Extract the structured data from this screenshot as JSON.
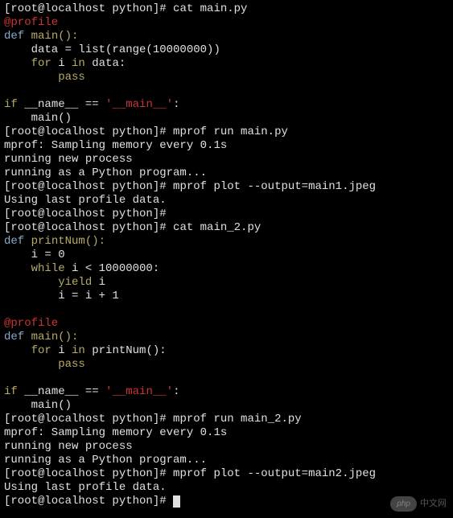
{
  "prompt": {
    "user_host": "root@localhost",
    "path": "python"
  },
  "lines": [
    {
      "type": "prompt",
      "command": "cat main.py"
    },
    {
      "type": "code_red",
      "text": "@profile"
    },
    {
      "type": "code",
      "parts": [
        {
          "c": "lightblue",
          "t": "def "
        },
        {
          "c": "yellow",
          "t": "main():"
        }
      ]
    },
    {
      "type": "code_plain",
      "text": "    data = list(range(10000000))"
    },
    {
      "type": "code",
      "parts": [
        {
          "c": "yellow",
          "t": "    for "
        },
        {
          "c": "",
          "t": "i "
        },
        {
          "c": "yellow",
          "t": "in "
        },
        {
          "c": "",
          "t": "data:"
        }
      ]
    },
    {
      "type": "code",
      "parts": [
        {
          "c": "yellow",
          "t": "        pass"
        }
      ]
    },
    {
      "type": "blank"
    },
    {
      "type": "code",
      "parts": [
        {
          "c": "yellow",
          "t": "if "
        },
        {
          "c": "",
          "t": "__name__ == "
        },
        {
          "c": "red",
          "t": "'__main__'"
        },
        {
          "c": "",
          "t": ":"
        }
      ]
    },
    {
      "type": "code_plain",
      "text": "    main()"
    },
    {
      "type": "prompt",
      "command": "mprof run main.py"
    },
    {
      "type": "out",
      "text": "mprof: Sampling memory every 0.1s"
    },
    {
      "type": "out",
      "text": "running new process"
    },
    {
      "type": "out",
      "text": "running as a Python program..."
    },
    {
      "type": "prompt",
      "command": "mprof plot --output=main1.jpeg"
    },
    {
      "type": "out",
      "text": "Using last profile data."
    },
    {
      "type": "prompt",
      "command": ""
    },
    {
      "type": "prompt",
      "command": "cat main_2.py"
    },
    {
      "type": "code",
      "parts": [
        {
          "c": "lightblue",
          "t": "def "
        },
        {
          "c": "yellow",
          "t": "printNum():"
        }
      ]
    },
    {
      "type": "code_plain",
      "text": "    i = 0"
    },
    {
      "type": "code",
      "parts": [
        {
          "c": "yellow",
          "t": "    while "
        },
        {
          "c": "",
          "t": "i < 10000000:"
        }
      ]
    },
    {
      "type": "code",
      "parts": [
        {
          "c": "yellow",
          "t": "        yield "
        },
        {
          "c": "",
          "t": "i"
        }
      ]
    },
    {
      "type": "code_plain",
      "text": "        i = i + 1"
    },
    {
      "type": "blank"
    },
    {
      "type": "code_red",
      "text": "@profile"
    },
    {
      "type": "code",
      "parts": [
        {
          "c": "lightblue",
          "t": "def "
        },
        {
          "c": "yellow",
          "t": "main():"
        }
      ]
    },
    {
      "type": "code",
      "parts": [
        {
          "c": "yellow",
          "t": "    for "
        },
        {
          "c": "",
          "t": "i "
        },
        {
          "c": "yellow",
          "t": "in "
        },
        {
          "c": "",
          "t": "printNum():"
        }
      ]
    },
    {
      "type": "code",
      "parts": [
        {
          "c": "yellow",
          "t": "        pass"
        }
      ]
    },
    {
      "type": "blank"
    },
    {
      "type": "code",
      "parts": [
        {
          "c": "yellow",
          "t": "if "
        },
        {
          "c": "",
          "t": "__name__ == "
        },
        {
          "c": "red",
          "t": "'__main__'"
        },
        {
          "c": "",
          "t": ":"
        }
      ]
    },
    {
      "type": "code_plain",
      "text": "    main()"
    },
    {
      "type": "prompt",
      "command": "mprof run main_2.py"
    },
    {
      "type": "out",
      "text": "mprof: Sampling memory every 0.1s"
    },
    {
      "type": "out",
      "text": "running new process"
    },
    {
      "type": "out",
      "text": "running as a Python program..."
    },
    {
      "type": "prompt",
      "command": "mprof plot --output=main2.jpeg"
    },
    {
      "type": "out",
      "text": "Using last profile data."
    },
    {
      "type": "prompt_cursor"
    }
  ],
  "watermark": {
    "badge": "php",
    "text": "中文网"
  }
}
